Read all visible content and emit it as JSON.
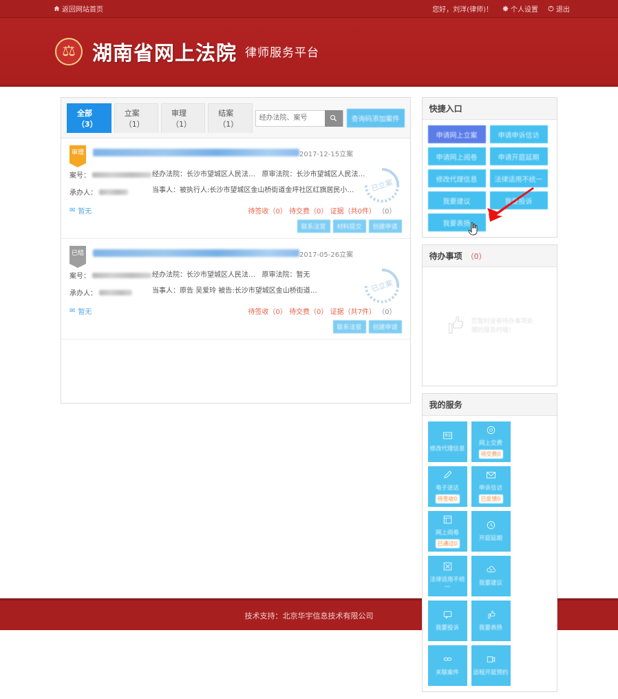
{
  "topbar": {
    "home_link": "返回网站首页",
    "greeting": "您好，刘洋(律师)！",
    "settings": "个人设置",
    "logout": "退出",
    "home_icon": "home-icon",
    "settings_icon": "gear-icon",
    "logout_icon": "power-icon"
  },
  "masthead": {
    "emblem_icon": "court-emblem-icon",
    "title": "湖南省网上法院",
    "subtitle": "律师服务平台",
    "bg_color": "#b02020"
  },
  "caselist": {
    "tabs": [
      {
        "label": "全部（3）",
        "active": true
      },
      {
        "label": "立案（1）",
        "active": false
      },
      {
        "label": "审理（1）",
        "active": false
      },
      {
        "label": "结案（1）",
        "active": false
      }
    ],
    "search": {
      "placeholder": "经办法院、案号",
      "value": "",
      "icon": "search-icon"
    },
    "query_button": "查询码添加案件",
    "cases": [
      {
        "status_badge": "审理",
        "badge_color": "#f5a623",
        "date": "2017-12-15立案",
        "stamp": "已立案",
        "case_no_label": "案号：",
        "case_no_value": "",
        "handler_label": "承办人：",
        "handler_value": "",
        "court_label": "经办法院：",
        "court_value": "长沙市望城区人民法…",
        "orig_court_label": "原审法院：",
        "orig_court_value": "长沙市望城区人民法…",
        "party_label": "当事人：",
        "party_value": "被执行人:长沙市望城区金山桥街道金坪社区红旗居民小…",
        "pin_label": "暂无",
        "stats": [
          "待签收（0）",
          "待交费（0）",
          "证据（共0件）",
          "（0）"
        ],
        "actions": [
          "联系法官",
          "材料提交",
          "创建申请"
        ]
      },
      {
        "status_badge": "已结",
        "badge_color": "#9e9e9e",
        "date": "2017-05-26立案",
        "stamp": "已立案",
        "case_no_label": "案号：",
        "case_no_value": "",
        "handler_label": "承办人：",
        "handler_value": "",
        "court_label": "经办法院：",
        "court_value": "长沙市望城区人民法…",
        "orig_court_label": "原审法院：",
        "orig_court_value": "暂无",
        "party_label": "当事人：",
        "party_value": "原告 吴爱玲 被告:长沙市望城区金山桥街道…",
        "pin_label": "暂无",
        "stats": [
          "待签收（0）",
          "待交费（0）",
          "证据（共7件）",
          "（0）"
        ],
        "actions": [
          "联系法官",
          "创建申请"
        ]
      }
    ]
  },
  "quick_entry": {
    "title": "快捷入口",
    "buttons": [
      {
        "label": "申请网上立案",
        "hover": true
      },
      {
        "label": "申请申诉信访",
        "hover": false
      },
      {
        "label": "申请网上阅卷",
        "hover": false
      },
      {
        "label": "申请开庭延期",
        "hover": false
      },
      {
        "label": "修改代理信息",
        "hover": false
      },
      {
        "label": "法律适用不统一",
        "hover": false
      },
      {
        "label": "我要建议",
        "hover": false
      },
      {
        "label": "我要投诉",
        "hover": false
      },
      {
        "label": "我要表扬",
        "hover": false
      }
    ]
  },
  "todo": {
    "title": "待办事项",
    "count": "（0）",
    "icon": "thumbs-up-icon",
    "empty_text": "您暂时没有待办事项处理的很及时哦！"
  },
  "my_service": {
    "title": "我的服务",
    "tiles": [
      {
        "label": "修改代理信息",
        "icon": "id-card-icon",
        "badge": ""
      },
      {
        "label": "网上交费",
        "icon": "coin-icon",
        "badge": "待交费0"
      },
      {
        "label": "电子送达",
        "icon": "pen-icon",
        "badge": "待签收0"
      },
      {
        "label": "申诉信访",
        "icon": "envelope-icon",
        "badge": "已反馈0"
      },
      {
        "label": "网上阅卷",
        "icon": "book-icon",
        "badge": "已通过0"
      },
      {
        "label": "开庭延期",
        "icon": "clock-icon",
        "badge": ""
      },
      {
        "label": "法律适用不统一",
        "icon": "scale-icon",
        "badge": ""
      },
      {
        "label": "我要建议",
        "icon": "cloud-up-icon",
        "badge": ""
      },
      {
        "label": "我要投诉",
        "icon": "speech-icon",
        "badge": ""
      },
      {
        "label": "我要表扬",
        "icon": "thumbs-up-icon",
        "badge": ""
      },
      {
        "label": "关联案件",
        "icon": "link-icon",
        "badge": ""
      },
      {
        "label": "远程开庭预约",
        "icon": "video-icon",
        "badge": ""
      }
    ]
  },
  "footer": {
    "text": "技术支持：北京华宇信息技术有限公司"
  },
  "annotation": {
    "arrow_color": "#ee1111",
    "cursor_icon": "hand-cursor-icon"
  }
}
